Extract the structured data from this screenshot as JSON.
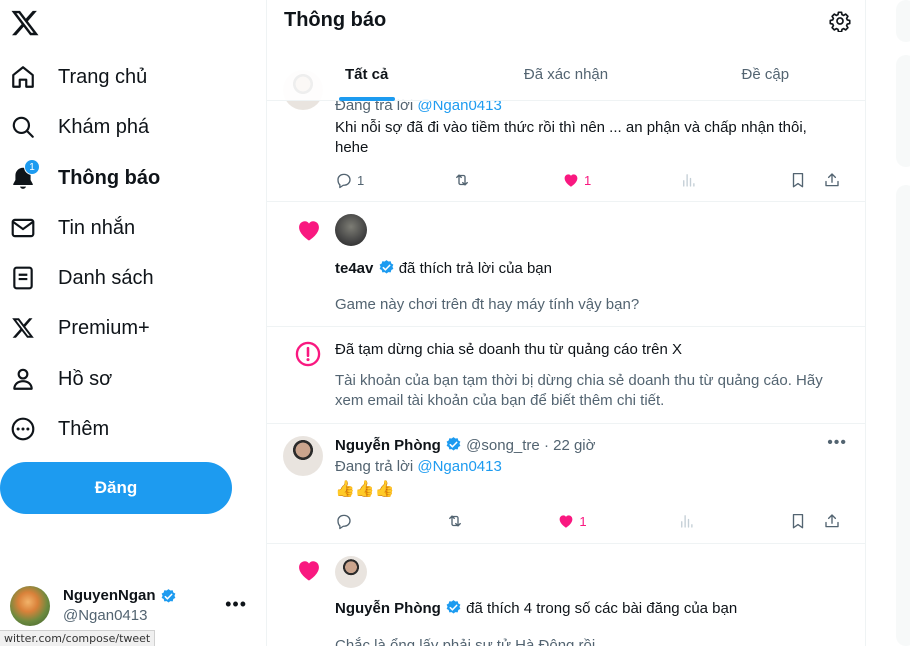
{
  "nav": {
    "items": [
      {
        "label": "Trang chủ",
        "icon": "home-icon"
      },
      {
        "label": "Khám phá",
        "icon": "search-icon"
      },
      {
        "label": "Thông báo",
        "icon": "bell-icon",
        "badge": "1"
      },
      {
        "label": "Tin nhắn",
        "icon": "mail-icon"
      },
      {
        "label": "Danh sách",
        "icon": "list-icon"
      },
      {
        "label": "Premium+",
        "icon": "x-icon"
      },
      {
        "label": "Hồ sơ",
        "icon": "person-icon"
      },
      {
        "label": "Thêm",
        "icon": "more-circle-icon"
      }
    ],
    "post_label": "Đăng"
  },
  "account": {
    "name": "NguyenNgan",
    "handle": "@Ngan0413",
    "more": "•••"
  },
  "status_url": "witter.com/compose/tweet",
  "header": {
    "title": "Thông báo",
    "tabs": [
      "Tất cả",
      "Đã xác nhận",
      "Đề cập"
    ]
  },
  "feed": {
    "item1": {
      "replying_prefix": "Đang trả lời",
      "replying_to": "@Ngan0413",
      "text": "Khi nỗi sợ đã đi vào tiềm thức rồi thì nên ... an phận và chấp nhận thôi, hehe",
      "reply_count": "1",
      "like_count": "1"
    },
    "item2": {
      "user": "te4av",
      "action": "đã thích trả lời của bạn",
      "quote": "Game này chơi trên đt hay máy tính vậy bạn?"
    },
    "item3": {
      "title": "Đã tạm dừng chia sẻ doanh thu từ quảng cáo trên X",
      "body": "Tài khoản của bạn tạm thời bị dừng chia sẻ doanh thu từ quảng cáo. Hãy xem email tài khoản của bạn để biết thêm chi tiết."
    },
    "item4": {
      "name": "Nguyễn Phòng",
      "handle": "@song_tre",
      "time": "· 22 giờ",
      "replying_prefix": "Đang trả lời",
      "replying_to": "@Ngan0413",
      "text": "👍👍👍",
      "like_count": "1",
      "more": "•••"
    },
    "item5": {
      "name": "Nguyễn Phòng",
      "action": "đã thích 4 trong số các bài đăng của bạn",
      "preview": "Chắc là ổng lấy phải sư tử Hà Đông rồi"
    }
  },
  "colors": {
    "accent": "#1d9bf0",
    "like": "#f91880",
    "text": "#0f1419",
    "muted": "#536471"
  }
}
